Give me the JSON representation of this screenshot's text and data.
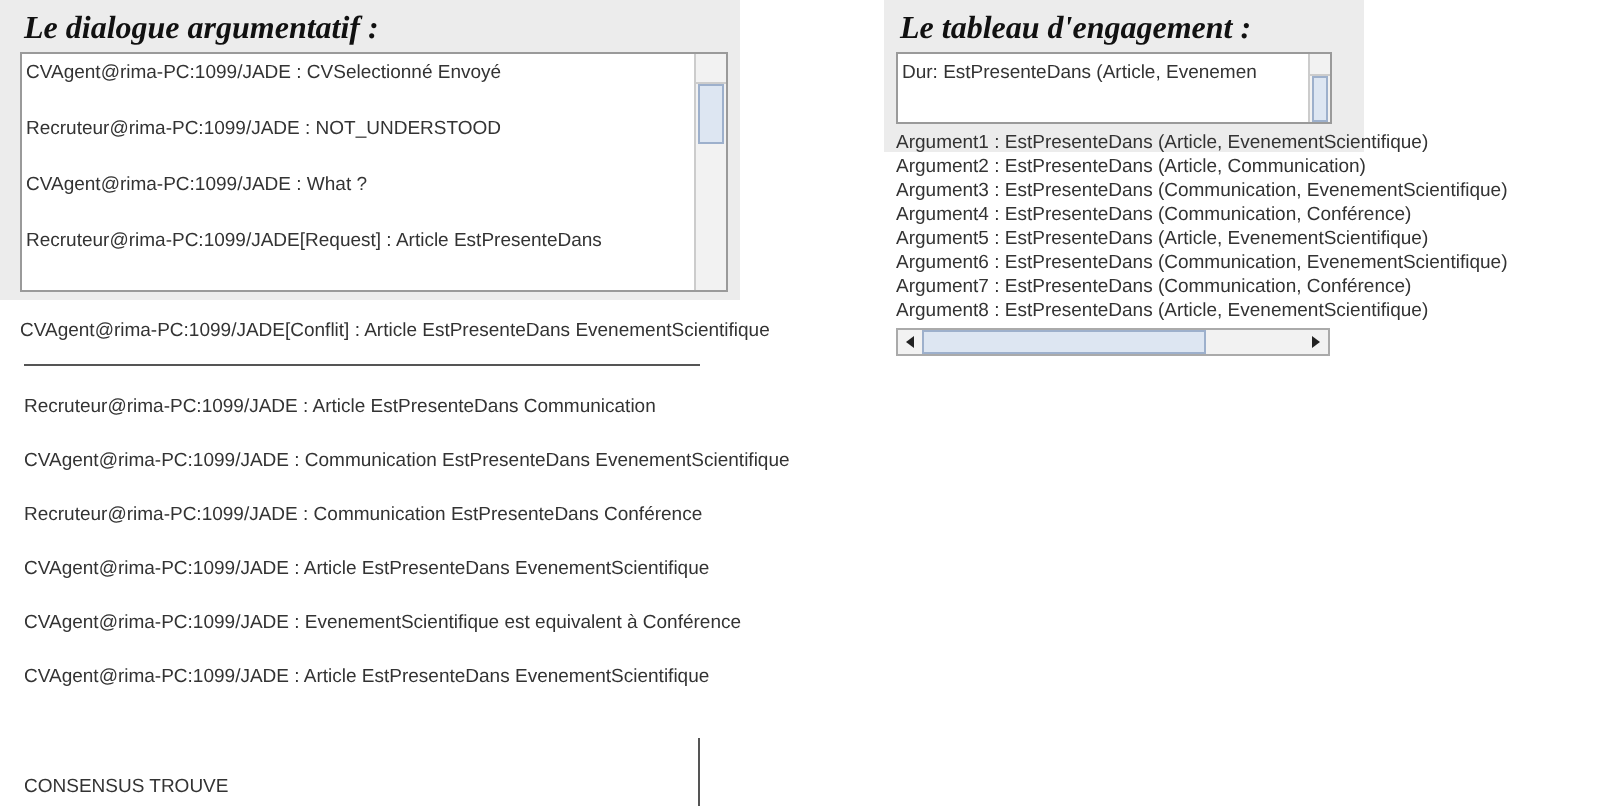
{
  "dialogue": {
    "title": "Le dialogue argumentatif :",
    "box_lines": [
      "CVAgent@rima-PC:1099/JADE : CVSelectionné Envoyé",
      "Recruteur@rima-PC:1099/JADE : NOT_UNDERSTOOD",
      "CVAgent@rima-PC:1099/JADE : What ?",
      "Recruteur@rima-PC:1099/JADE[Request] : Article EstPresenteDans"
    ],
    "conflict_line": "CVAgent@rima-PC:1099/JADE[Conflit] : Article EstPresenteDans EvenementScientifique",
    "lines": [
      "Recruteur@rima-PC:1099/JADE : Article EstPresenteDans Communication",
      "CVAgent@rima-PC:1099/JADE : Communication EstPresenteDans EvenementScientifique",
      "Recruteur@rima-PC:1099/JADE : Communication EstPresenteDans Conférence",
      "CVAgent@rima-PC:1099/JADE : Article EstPresenteDans EvenementScientifique",
      "CVAgent@rima-PC:1099/JADE : EvenementScientifique est equivalent à Conférence",
      "CVAgent@rima-PC:1099/JADE : Article EstPresenteDans EvenementScientifique"
    ],
    "status": "CONSENSUS TROUVE"
  },
  "engagement": {
    "title": "Le tableau d'engagement :",
    "box_line": "Dur: EstPresenteDans (Article, Evenemen",
    "arguments": [
      "Argument1 : EstPresenteDans (Article, EvenementScientifique)",
      "Argument2 : EstPresenteDans (Article, Communication)",
      "Argument3 : EstPresenteDans (Communication, EvenementScientifique)",
      "Argument4 : EstPresenteDans (Communication, Conférence)",
      "Argument5 : EstPresenteDans (Article, EvenementScientifique)",
      "Argument6 : EstPresenteDans (Communication, EvenementScientifique)",
      "Argument7 : EstPresenteDans (Communication, Conférence)",
      "Argument8 : EstPresenteDans (Article, EvenementScientifique)"
    ]
  }
}
